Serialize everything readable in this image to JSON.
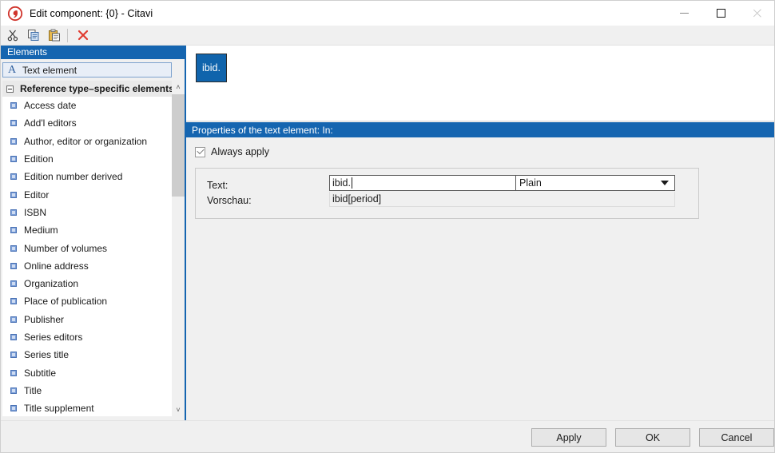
{
  "window": {
    "title": "Edit component: {0} - Citavi",
    "logo_icon": "citavi-logo-icon",
    "controls": {
      "minimize": "minimize-icon",
      "maximize": "maximize-icon",
      "close": "close-icon"
    }
  },
  "toolbar": {
    "buttons": [
      {
        "name": "cut-button",
        "icon": "scissors-icon"
      },
      {
        "name": "copy-button",
        "icon": "copy-icon"
      },
      {
        "name": "paste-button",
        "icon": "paste-icon"
      },
      {
        "name": "delete-button",
        "icon": "red-x-icon"
      }
    ]
  },
  "sidebar": {
    "header": "Elements",
    "selected": {
      "label": "Text element",
      "icon": "text-element-a-icon"
    },
    "group": {
      "title": "Reference type–specific elements",
      "collapse_icon": "collapse-minus-icon"
    },
    "items": [
      {
        "label": "Access date"
      },
      {
        "label": "Add'l editors"
      },
      {
        "label": "Author, editor or organization"
      },
      {
        "label": "Edition"
      },
      {
        "label": "Edition number derived"
      },
      {
        "label": "Editor"
      },
      {
        "label": "ISBN"
      },
      {
        "label": "Medium"
      },
      {
        "label": "Number of volumes"
      },
      {
        "label": "Online address"
      },
      {
        "label": "Organization"
      },
      {
        "label": "Place of publication"
      },
      {
        "label": "Publisher"
      },
      {
        "label": "Series editors"
      },
      {
        "label": "Series title"
      },
      {
        "label": "Subtitle"
      },
      {
        "label": "Title"
      },
      {
        "label": "Title supplement"
      }
    ],
    "scrollbar": {
      "up_arrow": "˄",
      "down_arrow": "˅"
    }
  },
  "canvas": {
    "chip_label": "ibid."
  },
  "properties": {
    "header": "Properties of the text element: In:",
    "always_apply": {
      "label": "Always apply",
      "checked": true
    },
    "fields": {
      "text_label": "Text:",
      "text_value": "ibid.",
      "format_value": "Plain",
      "preview_label": "Vorschau:",
      "preview_value": "ibid[period]"
    }
  },
  "footer": {
    "apply": "Apply",
    "ok": "OK",
    "cancel": "Cancel"
  },
  "colors": {
    "accent_blue": "#1565b0",
    "chip_blue": "#1064ac",
    "delete_red": "#e03a2f"
  }
}
